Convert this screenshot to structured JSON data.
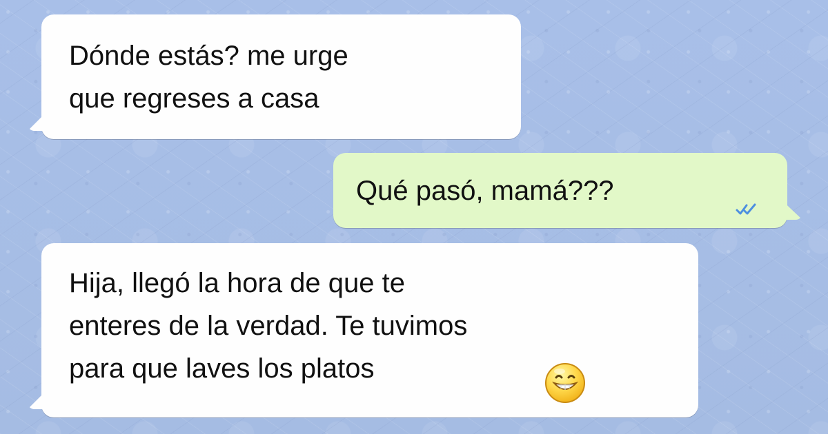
{
  "chat": {
    "messages": [
      {
        "sender": "incoming",
        "text": "Dónde estás? me urge\nque regreses a casa"
      },
      {
        "sender": "outgoing",
        "text": "Qué pasó, mamá???",
        "status_icon": "double-check-icon"
      },
      {
        "sender": "incoming",
        "text": "Hija, llegó la hora de que te\nenteres de la verdad. Te tuvimos\npara que laves los platos",
        "emoji_icon": "grinning-face-icon"
      }
    ]
  },
  "theme": {
    "background": "#a9bfe6",
    "incoming_bubble": "#fefefe",
    "outgoing_bubble": "#e2f8c8",
    "status_color": "#4d8fe0"
  }
}
